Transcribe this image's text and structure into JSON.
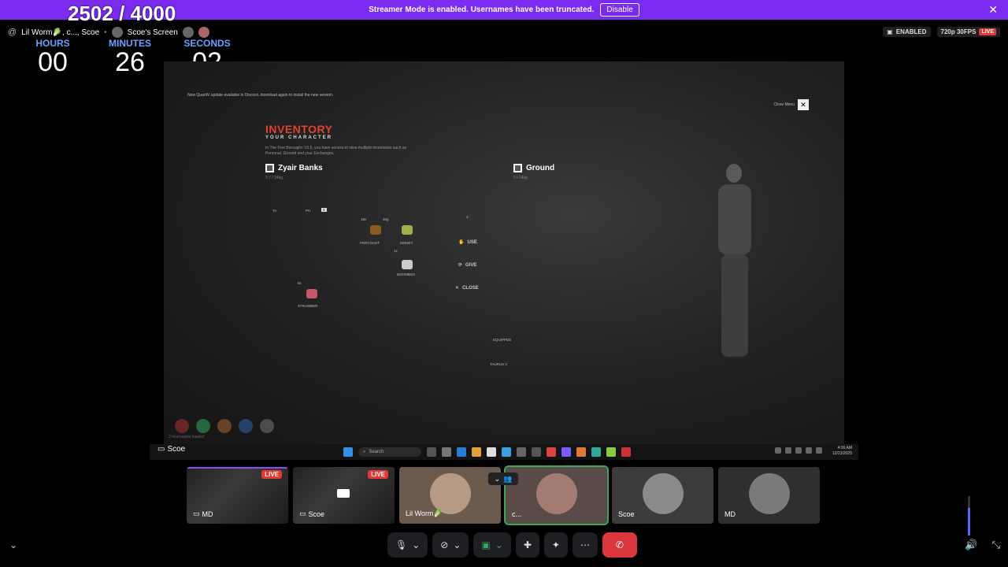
{
  "banner": {
    "message": "Streamer Mode is enabled. Usernames have been truncated.",
    "disable_label": "Disable",
    "close_icon": "close-icon",
    "color": "#7b2bf0"
  },
  "counter": {
    "text": "2502 / 4000"
  },
  "call_header": {
    "participants": "Lil Worm🥬, c..., Scoe",
    "screen_name": "Scoe's Screen"
  },
  "status": {
    "streamer_mode": "ENABLED",
    "quality": "720p 30FPS",
    "live": "LIVE"
  },
  "timer": {
    "hours_label": "HOURS",
    "hours": "00",
    "minutes_label": "MINUTES",
    "minutes": "26",
    "seconds_label": "SECONDS",
    "seconds": "02",
    "label_color": "#6aa0ff"
  },
  "stream": {
    "notice": "New QuantV update available in Discord, download again to install the new version.",
    "inventory_title": "INVENTORY",
    "inventory_subtitle": "YOUR CHARACTER",
    "inventory_desc": "In The Five Boroughs V3.5, you have access to view multiple inventories such as Personal, Ground and your Exchanges.",
    "player_panel": {
      "name": "Zyair Banks",
      "weight": "3.7 / 24kg"
    },
    "ground_panel": {
      "name": "Ground",
      "weight": "0 / 24kg"
    },
    "items": [
      {
        "name": "PERCOCET",
        "qty": "15x"
      },
      {
        "name": "MONEY",
        "qty": "30g"
      },
      {
        "name": "BOOMBOX",
        "qty": "1x"
      },
      {
        "name": "STRAWBER",
        "qty": "5x"
      }
    ],
    "slot_labels": {
      "a": "TA",
      "b": "PH",
      "c": "2",
      "d": "3"
    },
    "actions": {
      "use": "USE",
      "give": "GIVE",
      "close": "CLOSE"
    },
    "equipped": "EQUIPPED",
    "equipped_item": "TAURUS C",
    "close_menu": "Close Menu",
    "mod_packs": "2 mod packs loaded"
  },
  "taskbar": {
    "search": "Search",
    "time": "4:36 AM",
    "date": "12/23/2025",
    "stream_label": "Scoe"
  },
  "tiles": [
    {
      "name": "MD",
      "live": "LIVE"
    },
    {
      "name": "Scoe",
      "live": "LIVE"
    },
    {
      "name": "Lil Worm🥬"
    },
    {
      "name": "c..."
    },
    {
      "name": "Scoe"
    },
    {
      "name": "MD"
    }
  ],
  "controls": {
    "mic_icon": "microphone-icon",
    "camera_icon": "camera-off-icon",
    "share_icon": "screen-share-icon",
    "activities_icon": "activities-icon",
    "soundboard_icon": "soundboard-icon",
    "more_icon": "more-icon",
    "hangup_icon": "hang-up-icon"
  }
}
